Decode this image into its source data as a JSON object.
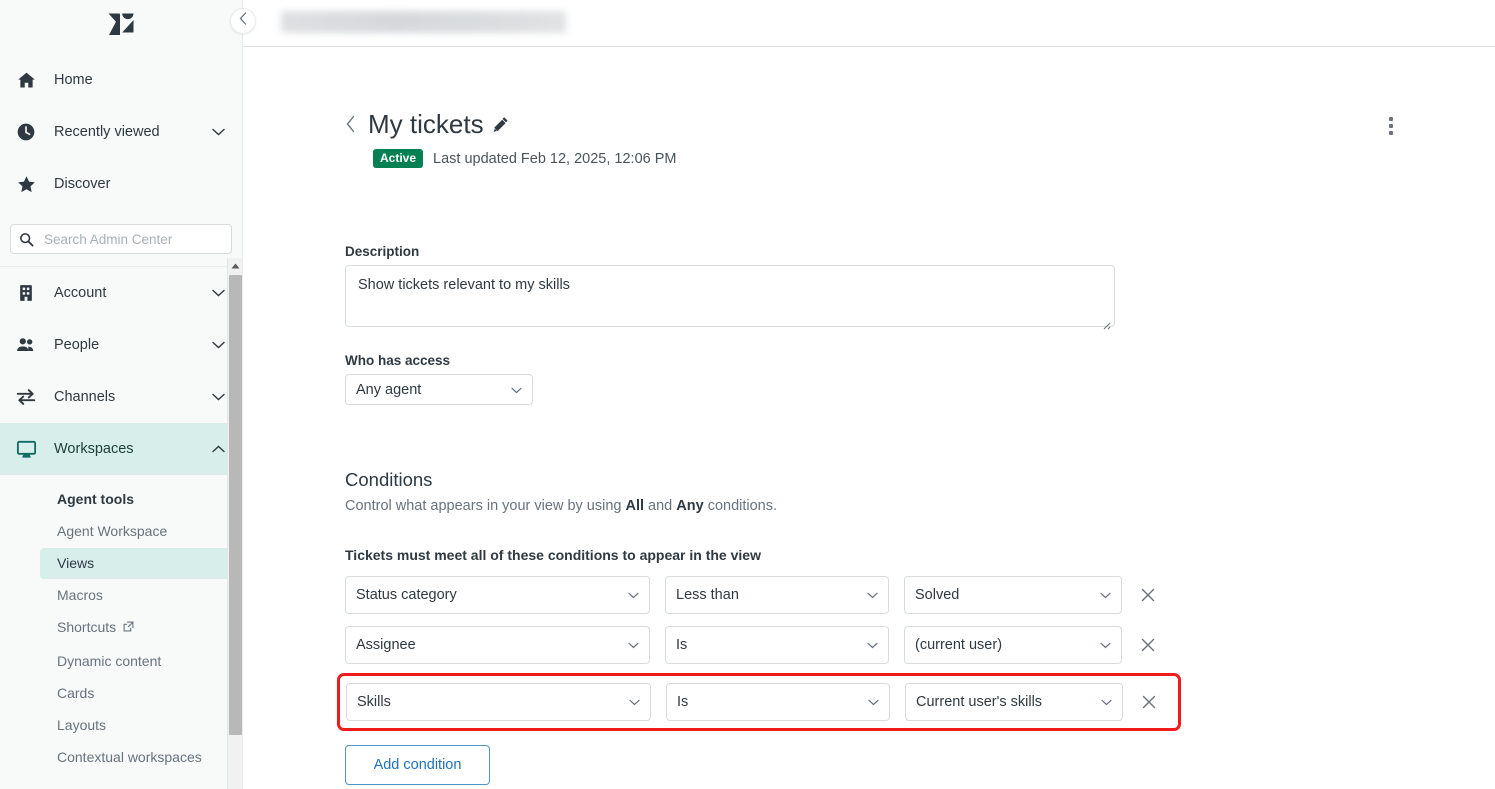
{
  "sidebar": {
    "logo_name": "zendesk-logo",
    "top_items": [
      {
        "label": "Home",
        "icon": "home-icon",
        "has_chevron": false
      },
      {
        "label": "Recently viewed",
        "icon": "clock-icon",
        "has_chevron": true
      },
      {
        "label": "Discover",
        "icon": "star-icon",
        "has_chevron": false
      }
    ],
    "search": {
      "placeholder": "Search Admin Center",
      "value": "",
      "icon": "search-icon"
    },
    "mid_items": [
      {
        "label": "Account",
        "icon": "building-icon",
        "has_chevron": true,
        "active": false
      },
      {
        "label": "People",
        "icon": "people-icon",
        "has_chevron": true,
        "active": false
      },
      {
        "label": "Channels",
        "icon": "channels-icon",
        "has_chevron": true,
        "active": false
      },
      {
        "label": "Workspaces",
        "icon": "monitor-icon",
        "has_chevron": true,
        "active": true
      }
    ],
    "subnav": {
      "heading": "Agent tools",
      "items": [
        {
          "label": "Agent Workspace",
          "selected": false,
          "external": false
        },
        {
          "label": "Views",
          "selected": true,
          "external": false
        },
        {
          "label": "Macros",
          "selected": false,
          "external": false
        },
        {
          "label": "Shortcuts",
          "selected": false,
          "external": true
        },
        {
          "label": "Dynamic content",
          "selected": false,
          "external": false
        },
        {
          "label": "Cards",
          "selected": false,
          "external": false
        },
        {
          "label": "Layouts",
          "selected": false,
          "external": false
        },
        {
          "label": "Contextual workspaces",
          "selected": false,
          "external": false
        }
      ]
    }
  },
  "topbar": {
    "collapse_icon": "chevron-left-icon",
    "url_redacted": ""
  },
  "header": {
    "back_icon": "chevron-left-icon",
    "title": "My tickets",
    "edit_icon": "pencil-icon",
    "status_badge": "Active",
    "meta": "Last updated Feb 12, 2025, 12:06 PM",
    "menu_icon": "kebab-menu-icon"
  },
  "description": {
    "label": "Description",
    "value": "Show tickets relevant to my skills",
    "placeholder": ""
  },
  "access": {
    "label": "Who has access",
    "value": "Any agent"
  },
  "conditions": {
    "title": "Conditions",
    "subtitle_pre": "Control what appears in your view by using ",
    "subtitle_all": "All",
    "subtitle_mid": " and ",
    "subtitle_any": "Any",
    "subtitle_post": " conditions.",
    "all_heading": "Tickets must meet all of these conditions to appear in the view",
    "rows": [
      {
        "field": "Status category",
        "operator": "Less than",
        "value": "Solved",
        "highlighted": false
      },
      {
        "field": "Assignee",
        "operator": "Is",
        "value": "(current user)",
        "highlighted": false
      },
      {
        "field": "Skills",
        "operator": "Is",
        "value": "Current user's skills",
        "highlighted": true
      }
    ],
    "add_button": "Add condition"
  },
  "colors": {
    "accent_teal": "#d7eeeb",
    "badge_green": "#038153",
    "link_blue": "#1f73b7",
    "highlight_red": "#f01c1c",
    "border_grey": "#d8dcde"
  }
}
